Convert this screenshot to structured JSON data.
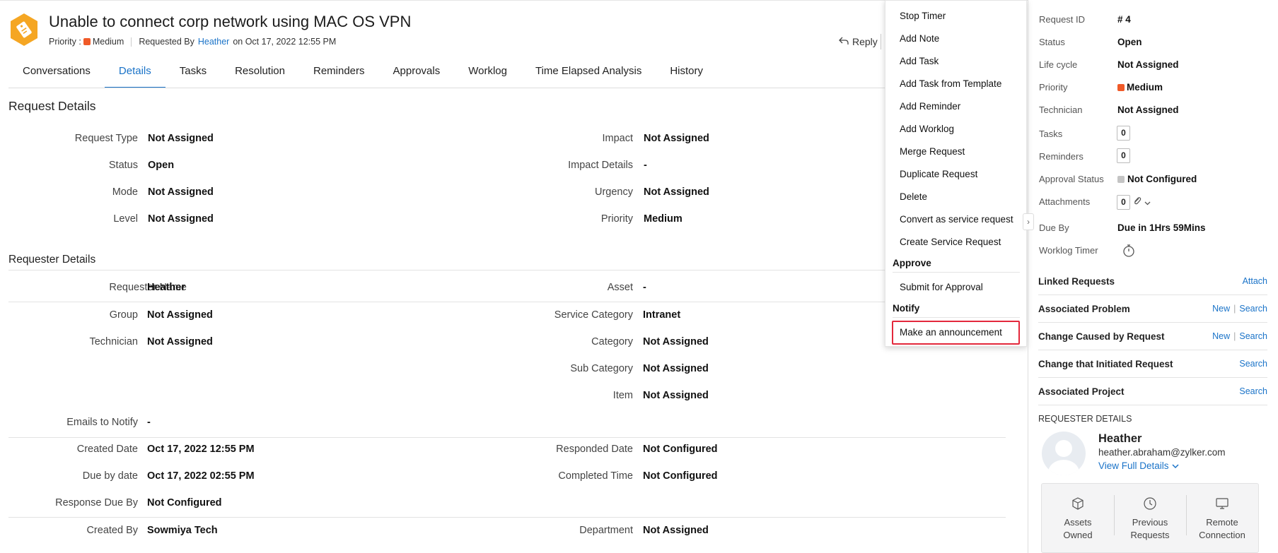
{
  "header": {
    "title": "Unable to connect corp network using MAC OS VPN",
    "priority_label": "Priority :",
    "priority_value": "Medium",
    "requested_by_label": "Requested By",
    "requester": "Heather",
    "date": "on Oct 17, 2022 12:55 PM",
    "reply": "Reply",
    "priority_color": "#f05a28"
  },
  "tabs": [
    {
      "label": "Conversations"
    },
    {
      "label": "Details"
    },
    {
      "label": "Tasks"
    },
    {
      "label": "Resolution"
    },
    {
      "label": "Reminders"
    },
    {
      "label": "Approvals"
    },
    {
      "label": "Worklog"
    },
    {
      "label": "Time Elapsed Analysis"
    },
    {
      "label": "History"
    }
  ],
  "request_details": {
    "heading": "Request Details",
    "fields": {
      "request_type": {
        "label": "Request Type",
        "value": "Not Assigned"
      },
      "status": {
        "label": "Status",
        "value": "Open"
      },
      "mode": {
        "label": "Mode",
        "value": "Not Assigned"
      },
      "level": {
        "label": "Level",
        "value": "Not Assigned"
      },
      "impact": {
        "label": "Impact",
        "value": "Not Assigned"
      },
      "impact_details": {
        "label": "Impact Details",
        "value": "-"
      },
      "urgency": {
        "label": "Urgency",
        "value": "Not Assigned"
      },
      "priority": {
        "label": "Priority",
        "value": "Medium"
      }
    }
  },
  "requester_details": {
    "heading": "Requester Details",
    "fields": {
      "requester_name": {
        "label": "Requester Name",
        "value": "Heather"
      },
      "group": {
        "label": "Group",
        "value": "Not Assigned"
      },
      "technician": {
        "label": "Technician",
        "value": "Not Assigned"
      },
      "asset": {
        "label": "Asset",
        "value": "-"
      },
      "service_category": {
        "label": "Service Category",
        "value": "Intranet"
      },
      "category": {
        "label": "Category",
        "value": "Not Assigned"
      },
      "sub_category": {
        "label": "Sub Category",
        "value": "Not Assigned"
      },
      "item": {
        "label": "Item",
        "value": "Not Assigned"
      },
      "emails_to_notify": {
        "label": "Emails to Notify",
        "value": "-"
      },
      "created_date": {
        "label": "Created Date",
        "value": "Oct 17, 2022 12:55 PM"
      },
      "due_by_date": {
        "label": "Due by date",
        "value": "Oct 17, 2022 02:55 PM"
      },
      "response_due_by": {
        "label": "Response Due By",
        "value": "Not Configured"
      },
      "responded_date": {
        "label": "Responded Date",
        "value": "Not Configured"
      },
      "completed_time": {
        "label": "Completed Time",
        "value": "Not Configured"
      },
      "created_by": {
        "label": "Created By",
        "value": "Sowmiya Tech"
      },
      "department": {
        "label": "Department",
        "value": "Not Assigned"
      }
    }
  },
  "menu": {
    "items": [
      "Stop Timer",
      "Add Note",
      "Add Task",
      "Add Task from Template",
      "Add Reminder",
      "Add Worklog",
      "Merge Request",
      "Duplicate Request",
      "Delete",
      "Convert as service request",
      "Create Service Request"
    ],
    "approve_group": "Approve",
    "submit_for_approval": "Submit for Approval",
    "notify_group": "Notify",
    "make_announcement": "Make an announcement",
    "highlight_color": "#e3283c"
  },
  "side": {
    "request_id_label": "Request ID",
    "request_id": "# 4",
    "status_label": "Status",
    "status": "Open",
    "lifecycle_label": "Life cycle",
    "lifecycle": "Not Assigned",
    "priority_label": "Priority",
    "priority": "Medium",
    "technician_label": "Technician",
    "technician": "Not Assigned",
    "tasks_label": "Tasks",
    "tasks_count": "0",
    "reminders_label": "Reminders",
    "reminders_count": "0",
    "approval_label": "Approval Status",
    "approval": "Not Configured",
    "attachments_label": "Attachments",
    "attachments_count": "0",
    "due_by_label": "Due By",
    "due_by": "Due in 1Hrs 59Mins",
    "worklog_timer_label": "Worklog Timer",
    "sections": {
      "linked": {
        "title": "Linked Requests",
        "attach": "Attach"
      },
      "problem": {
        "title": "Associated Problem",
        "new": "New",
        "search": "Search"
      },
      "change_caused": {
        "title": "Change Caused by Request",
        "new": "New",
        "search": "Search"
      },
      "change_initiated": {
        "title": "Change that Initiated Request",
        "search": "Search"
      },
      "project": {
        "title": "Associated Project",
        "search": "Search"
      }
    },
    "requester_heading": "REQUESTER DETAILS",
    "requester_name": "Heather",
    "requester_email": "heather.abraham@zylker.com",
    "view_full_details": "View Full Details",
    "tiles": {
      "assets_1": "Assets",
      "assets_2": "Owned",
      "previous_1": "Previous",
      "previous_2": "Requests",
      "remote_1": "Remote",
      "remote_2": "Connection"
    }
  }
}
